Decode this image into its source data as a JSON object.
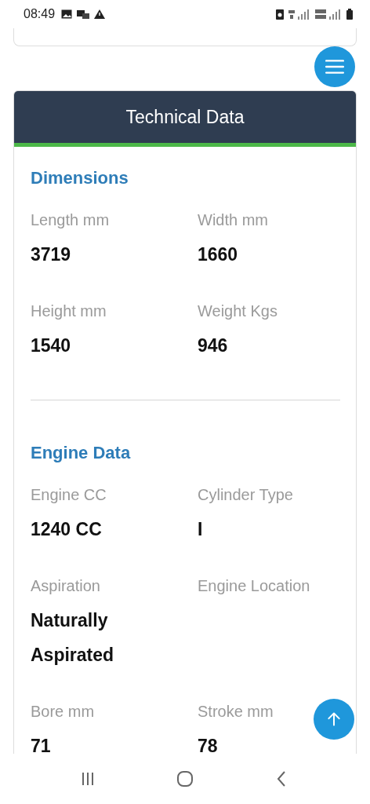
{
  "status_bar": {
    "time": "08:49"
  },
  "section_title": "Technical Data",
  "groups": [
    {
      "heading": "Dimensions",
      "specs": [
        {
          "label": "Length mm",
          "value": "3719"
        },
        {
          "label": "Width mm",
          "value": "1660"
        },
        {
          "label": "Height mm",
          "value": "1540"
        },
        {
          "label": "Weight Kgs",
          "value": "946"
        }
      ]
    },
    {
      "heading": "Engine Data",
      "specs": [
        {
          "label": "Engine CC",
          "value": "1240 CC"
        },
        {
          "label": "Cylinder Type",
          "value": "I"
        },
        {
          "label": "Aspiration",
          "value": "Naturally Aspirated"
        },
        {
          "label": "Engine Location"
        },
        {
          "label": "Bore mm",
          "value": "71"
        },
        {
          "label": "Stroke mm",
          "value": "78"
        }
      ]
    }
  ]
}
